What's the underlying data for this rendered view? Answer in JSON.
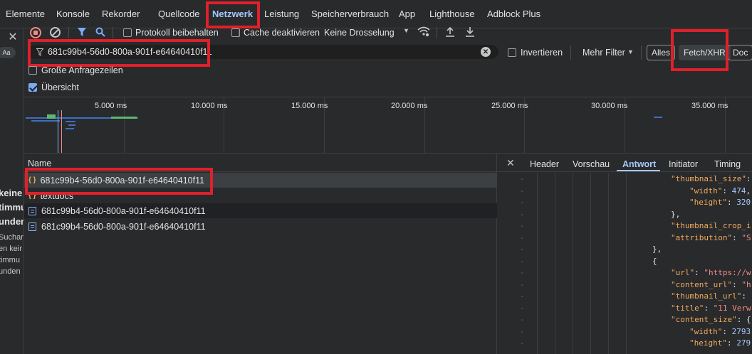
{
  "main_tabs": [
    {
      "label": "Elemente"
    },
    {
      "label": "Konsole"
    },
    {
      "label": "Rekorder"
    },
    {
      "label": "Quellcode"
    },
    {
      "label": "Netzwerk"
    },
    {
      "label": "Leistung"
    },
    {
      "label": "Speicherverbrauch"
    },
    {
      "label": "App"
    },
    {
      "label": "Lighthouse"
    },
    {
      "label": "Adblock Plus"
    }
  ],
  "toolbar": {
    "preserve_log_label": "Protokoll beibehalten",
    "disable_cache_label": "Cache deaktivieren",
    "throttle_label": "Keine Drosselung"
  },
  "filter_bar": {
    "filter_value": "681c99b4-56d0-800a-901f-e64640410f11",
    "invert_label": "Invertieren",
    "more_filters_label": "Mehr Filter",
    "type_buttons": [
      "Alles",
      "Fetch/XHR",
      "Doc"
    ]
  },
  "options": {
    "big_rows_label": "Große Anfragezeilen",
    "overview_label": "Übersicht"
  },
  "timeline": {
    "ticks": [
      "5.000 ms",
      "10.000 ms",
      "15.000 ms",
      "20.000 ms",
      "25.000 ms",
      "30.000 ms",
      "35.000 ms"
    ]
  },
  "requests": {
    "column_name": "Name",
    "rows": [
      {
        "name": "681c99b4-56d0-800a-901f-e64640410f11",
        "type": "xhr"
      },
      {
        "name": "textdocs",
        "type": "xhr"
      },
      {
        "name": "681c99b4-56d0-800a-901f-e64640410f11",
        "type": "doc"
      },
      {
        "name": "681c99b4-56d0-800a-901f-e64640410f11",
        "type": "doc"
      }
    ]
  },
  "detail_tabs": [
    "Header",
    "Vorschau",
    "Antwort",
    "Initiator",
    "Timing"
  ],
  "response_lines": [
    {
      "indent": 0,
      "parts": [
        [
          "key",
          "\"thumbnail_size\""
        ],
        [
          "p",
          ": "
        ]
      ]
    },
    {
      "indent": 1,
      "parts": [
        [
          "key",
          "\"width\""
        ],
        [
          "p",
          ": "
        ],
        [
          "num",
          "474"
        ],
        [
          "p",
          ","
        ]
      ]
    },
    {
      "indent": 1,
      "parts": [
        [
          "key",
          "\"height\""
        ],
        [
          "p",
          ": "
        ],
        [
          "num",
          "320"
        ]
      ]
    },
    {
      "indent": 0,
      "parts": [
        [
          "p",
          "},"
        ]
      ]
    },
    {
      "indent": 0,
      "parts": [
        [
          "key",
          "\"thumbnail_crop_i"
        ]
      ]
    },
    {
      "indent": 0,
      "parts": [
        [
          "key",
          "\"attribution\""
        ],
        [
          "p",
          ": "
        ],
        [
          "str",
          "\"S"
        ]
      ]
    },
    {
      "indent": -1,
      "parts": [
        [
          "p",
          "},"
        ]
      ]
    },
    {
      "indent": -1,
      "parts": [
        [
          "p",
          "{"
        ]
      ]
    },
    {
      "indent": 0,
      "parts": [
        [
          "key",
          "\"url\""
        ],
        [
          "p",
          ": "
        ],
        [
          "str",
          "\"https://w"
        ]
      ]
    },
    {
      "indent": 0,
      "parts": [
        [
          "key",
          "\"content_url\""
        ],
        [
          "p",
          ": "
        ],
        [
          "str",
          "\"h"
        ]
      ]
    },
    {
      "indent": 0,
      "parts": [
        [
          "key",
          "\"thumbnail_url\""
        ],
        [
          "p",
          ": "
        ]
      ]
    },
    {
      "indent": 0,
      "parts": [
        [
          "key",
          "\"title\""
        ],
        [
          "p",
          ": "
        ],
        [
          "str",
          "\"11 Verw"
        ]
      ]
    },
    {
      "indent": 0,
      "parts": [
        [
          "key",
          "\"content_size\""
        ],
        [
          "p",
          ": {"
        ]
      ]
    },
    {
      "indent": 1,
      "parts": [
        [
          "key",
          "\"width\""
        ],
        [
          "p",
          ": "
        ],
        [
          "num",
          "2793"
        ]
      ]
    },
    {
      "indent": 1,
      "parts": [
        [
          "key",
          "\"height\""
        ],
        [
          "p",
          ": "
        ],
        [
          "num",
          "279"
        ]
      ]
    }
  ],
  "left_page_fragment": {
    "lines_bold": [
      "keine",
      "timmu",
      "unden"
    ],
    "lines_small": [
      "Suchar",
      "en keir",
      "timmu",
      "unden"
    ],
    "aa_label": "Aa"
  }
}
